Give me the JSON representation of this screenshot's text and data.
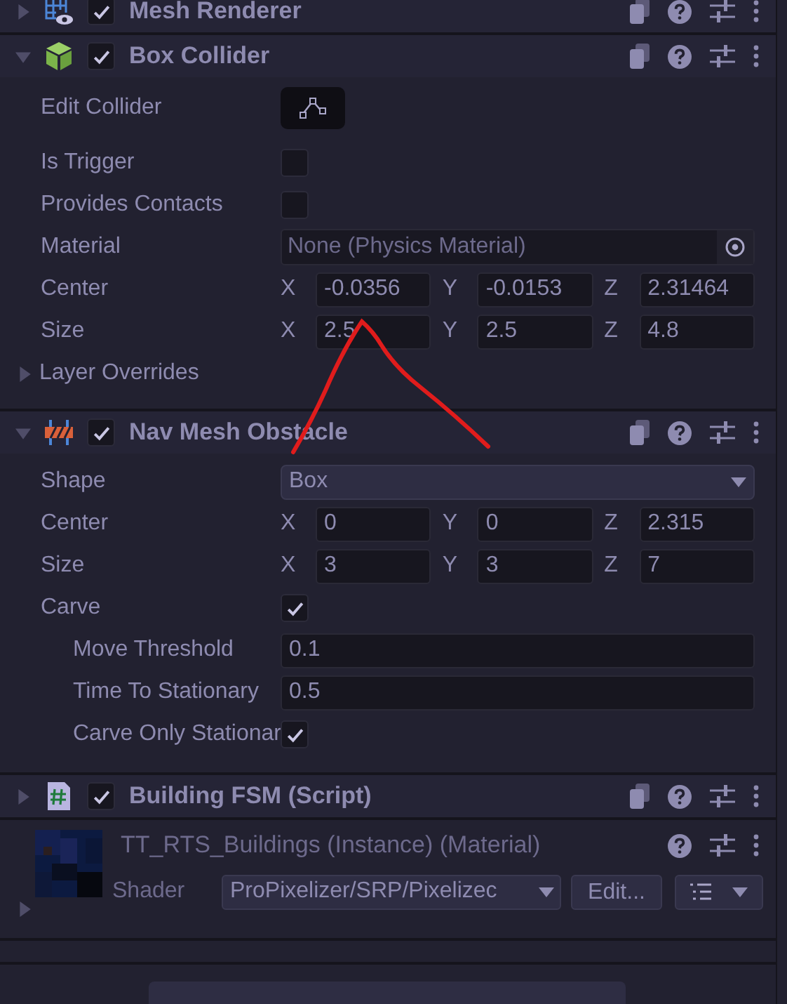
{
  "components": [
    {
      "title": "Mesh Renderer",
      "expanded": false,
      "enabled": true
    },
    {
      "title": "Box Collider",
      "expanded": true,
      "enabled": true,
      "properties": [
        {
          "kind": "button",
          "label": "Edit Collider"
        },
        {
          "kind": "checkbox",
          "label": "Is Trigger",
          "checked": false
        },
        {
          "kind": "checkbox",
          "label": "Provides Contacts",
          "checked": false
        },
        {
          "kind": "object",
          "label": "Material",
          "value": "None (Physics Material)"
        },
        {
          "kind": "vector",
          "label": "Center",
          "axes": [
            {
              "axis": "X",
              "value": "-0.0356"
            },
            {
              "axis": "Y",
              "value": "-0.0153"
            },
            {
              "axis": "Z",
              "value": "2.31464"
            }
          ]
        },
        {
          "kind": "vector",
          "label": "Size",
          "axes": [
            {
              "axis": "X",
              "value": "2.5"
            },
            {
              "axis": "Y",
              "value": "2.5"
            },
            {
              "axis": "Z",
              "value": "4.8"
            }
          ]
        },
        {
          "kind": "foldout",
          "label": "Layer Overrides",
          "expanded": false
        }
      ]
    },
    {
      "title": "Nav Mesh Obstacle",
      "expanded": true,
      "enabled": true,
      "properties": [
        {
          "kind": "dropdown",
          "label": "Shape",
          "value": "Box"
        },
        {
          "kind": "vector",
          "label": "Center",
          "axes": [
            {
              "axis": "X",
              "value": "0"
            },
            {
              "axis": "Y",
              "value": "0"
            },
            {
              "axis": "Z",
              "value": "2.315"
            }
          ]
        },
        {
          "kind": "vector",
          "label": "Size",
          "axes": [
            {
              "axis": "X",
              "value": "3"
            },
            {
              "axis": "Y",
              "value": "3"
            },
            {
              "axis": "Z",
              "value": "7"
            }
          ]
        },
        {
          "kind": "checkbox",
          "label": "Carve",
          "checked": true,
          "children": [
            {
              "kind": "number",
              "label": "Move Threshold",
              "value": "0.1"
            },
            {
              "kind": "number",
              "label": "Time To Stationary",
              "value": "0.5"
            },
            {
              "kind": "checkbox",
              "label": "Carve Only Stationar",
              "checked": true
            }
          ]
        }
      ]
    },
    {
      "title": "Building FSM (Script)",
      "expanded": false,
      "enabled": true
    }
  ],
  "material": {
    "title": "TT_RTS_Buildings (Instance) (Material)",
    "expanded": false,
    "shader_label": "Shader",
    "shader": "ProPixelizer/SRP/Pixelizec",
    "edit_button": "Edit..."
  }
}
